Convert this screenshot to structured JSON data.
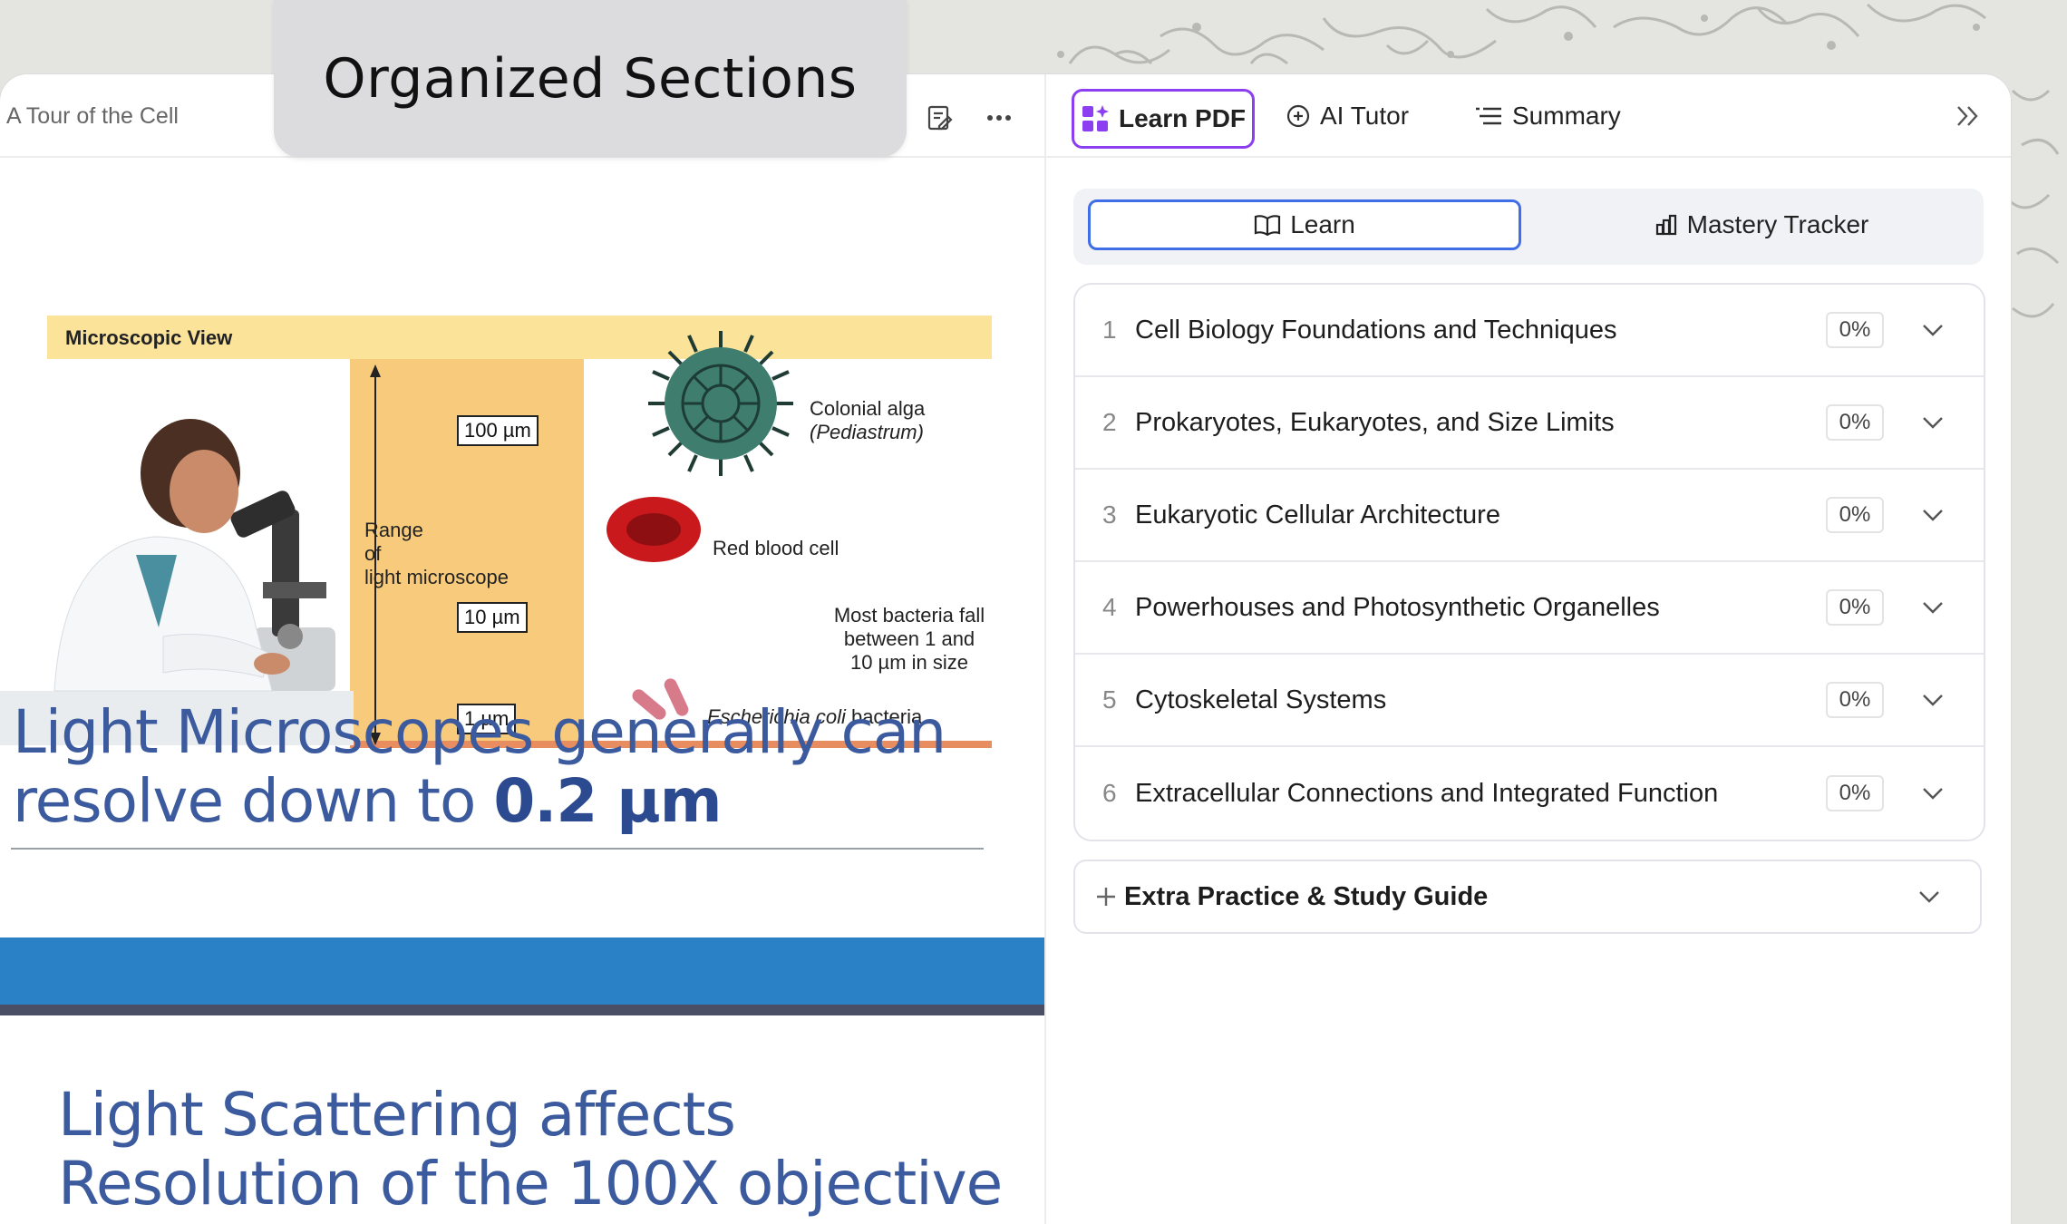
{
  "overlay": {
    "title": "Organized Sections"
  },
  "document": {
    "title": "A Tour of the Cell",
    "figure": {
      "band_label": "Microscopic View",
      "sizes": [
        "100 µm",
        "10 µm",
        "1 µm"
      ],
      "range_label": [
        "Range",
        "of",
        "light microscope"
      ],
      "alga_label": [
        "Colonial alga",
        "(Pediastrum)"
      ],
      "rbc_label": "Red blood cell",
      "bacteria_note": [
        "Most bacteria fall",
        "between 1 and",
        "10 µm in size"
      ],
      "ecoli_label": [
        "Escherichia coli",
        " bacteria"
      ]
    },
    "heading1_prefix": "Light Microscopes generally can resolve down to ",
    "heading1_value": "0.2 µm",
    "heading2": "Light Scattering affects Resolution of the 100X objective"
  },
  "right_panel": {
    "tabs": {
      "learn_pdf": "Learn PDF",
      "ai_tutor": "AI Tutor",
      "summary": "Summary"
    },
    "segment": {
      "learn": "Learn",
      "mastery": "Mastery Tracker"
    },
    "sections": [
      {
        "num": "1",
        "title": "Cell Biology Foundations and Techniques",
        "progress": "0%"
      },
      {
        "num": "2",
        "title": "Prokaryotes, Eukaryotes, and Size Limits",
        "progress": "0%"
      },
      {
        "num": "3",
        "title": "Eukaryotic Cellular Architecture",
        "progress": "0%"
      },
      {
        "num": "4",
        "title": "Powerhouses and Photosynthetic Organelles",
        "progress": "0%"
      },
      {
        "num": "5",
        "title": "Cytoskeletal Systems",
        "progress": "0%"
      },
      {
        "num": "6",
        "title": "Extracellular Connections and Integrated Function",
        "progress": "0%"
      }
    ],
    "extra": {
      "title": "Extra Practice & Study Guide"
    },
    "colors": {
      "accent_purple": "#8b3ff0",
      "accent_blue": "#3f6ee6"
    }
  }
}
